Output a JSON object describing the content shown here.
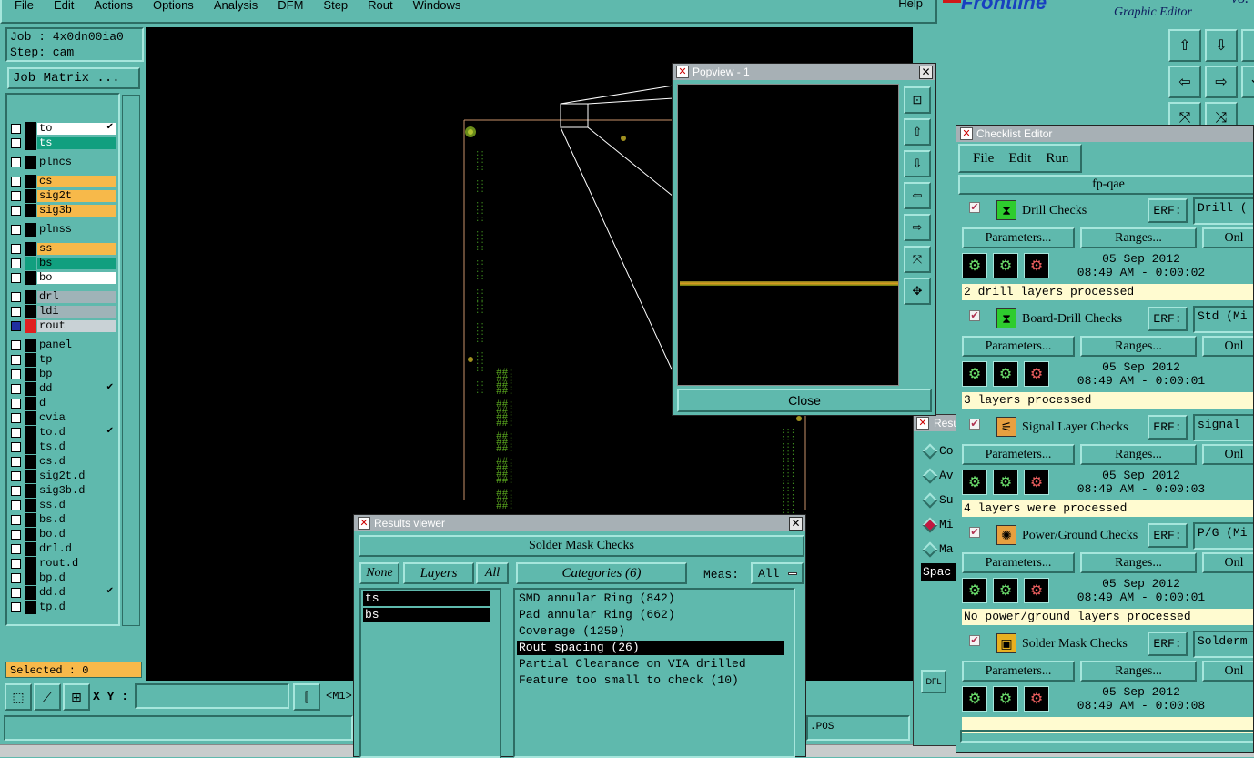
{
  "menu": [
    "File",
    "Edit",
    "Actions",
    "Options",
    "Analysis",
    "DFM",
    "Step",
    "Rout",
    "Windows"
  ],
  "help": "Help",
  "brand": {
    "logo": "Frontline",
    "subtitle": "Graphic Editor",
    "version": "v8."
  },
  "job": {
    "job_label": "Job : 4x0dn00ia0",
    "step_label": "Step: cam",
    "matrix_button": "Job Matrix ..."
  },
  "layers": [
    {
      "name": "to",
      "color": "#ffffff",
      "tick": true
    },
    {
      "name": "ts",
      "color": "#119f7f",
      "tick": false
    },
    {
      "name": "plncs",
      "color": "#5fb9ad",
      "tick": false
    },
    {
      "name": "cs",
      "color": "#f7b94a",
      "tick": false
    },
    {
      "name": "sig2t",
      "color": "#f7b94a",
      "tick": false
    },
    {
      "name": "sig3b",
      "color": "#f7b94a",
      "tick": false
    },
    {
      "name": "plnss",
      "color": "#5fb9ad",
      "tick": false
    },
    {
      "name": "ss",
      "color": "#f7b94a",
      "tick": false
    },
    {
      "name": "bs",
      "color": "#119f7f",
      "tick": false
    },
    {
      "name": "bo",
      "color": "#ffffff",
      "tick": false
    },
    {
      "name": "drl",
      "color": "#9fb3b8",
      "tick": false
    },
    {
      "name": "ldi",
      "color": "#9fb3b8",
      "tick": false
    },
    {
      "name": "rout",
      "color": "#c9d2d6",
      "tick": false
    },
    {
      "name": "panel",
      "color": "#5fb9ad",
      "tick": false
    },
    {
      "name": "tp",
      "color": "#5fb9ad",
      "tick": false
    },
    {
      "name": "bp",
      "color": "#5fb9ad",
      "tick": false
    },
    {
      "name": "dd",
      "color": "#5fb9ad",
      "tick": true
    },
    {
      "name": "d",
      "color": "#5fb9ad",
      "tick": false
    },
    {
      "name": "cvia",
      "color": "#5fb9ad",
      "tick": false
    },
    {
      "name": "to.d",
      "color": "#5fb9ad",
      "tick": true
    },
    {
      "name": "ts.d",
      "color": "#5fb9ad",
      "tick": false
    },
    {
      "name": "cs.d",
      "color": "#5fb9ad",
      "tick": false
    },
    {
      "name": "sig2t.d",
      "color": "#5fb9ad",
      "tick": false
    },
    {
      "name": "sig3b.d",
      "color": "#5fb9ad",
      "tick": false
    },
    {
      "name": "ss.d",
      "color": "#5fb9ad",
      "tick": false
    },
    {
      "name": "bs.d",
      "color": "#5fb9ad",
      "tick": false
    },
    {
      "name": "bo.d",
      "color": "#5fb9ad",
      "tick": false
    },
    {
      "name": "drl.d",
      "color": "#5fb9ad",
      "tick": false
    },
    {
      "name": "rout.d",
      "color": "#5fb9ad",
      "tick": false
    },
    {
      "name": "bp.d",
      "color": "#5fb9ad",
      "tick": false
    },
    {
      "name": "dd.d",
      "color": "#5fb9ad",
      "tick": true
    },
    {
      "name": "tp.d",
      "color": "#5fb9ad",
      "tick": false
    }
  ],
  "selected": "Selected : 0",
  "coords": {
    "xy_label": "X Y :",
    "xy_value": "",
    "unit": "<M1>"
  },
  "popview": {
    "title": "Popview - 1",
    "close": "Close"
  },
  "results": {
    "title": "Results viewer",
    "header": "Solder Mask Checks",
    "none": "None",
    "layers": "Layers",
    "all": "All",
    "categories_label": "Categories (6)",
    "meas_label": "Meas:",
    "meas_value": "All",
    "layer_items": [
      "ts",
      "bs"
    ],
    "categories": [
      "SMD annular Ring (842)",
      "Pad annular Ring (662)",
      "Coverage (1259)",
      "Rout spacing (26)",
      "Partial Clearance on VIA drilled",
      "Feature too small to check (10)"
    ],
    "selected_category": "Rout spacing (26)"
  },
  "res_behind": {
    "title": "Resu",
    "items": [
      "Co",
      "Av",
      "Su",
      "Mi",
      "Ma"
    ],
    "field": "Spac",
    "button": "DFL"
  },
  "checklist": {
    "title": "Checklist Editor",
    "menu": [
      "File",
      "Edit",
      "Run"
    ],
    "name": "fp-qae",
    "params_label": "Parameters...",
    "ranges_label": "Ranges...",
    "on_label": "Onl",
    "erf_label": "ERF:",
    "checks": [
      {
        "name": "Drill Checks",
        "erf": "Drill (",
        "date": "05 Sep 2012",
        "time": "08:49 AM - 0:00:02",
        "status": "2 drill layers processed",
        "icon": "drill-icon",
        "icon_color": "#2ecc2e"
      },
      {
        "name": "Board-Drill Checks",
        "erf": "Std (Mi",
        "date": "05 Sep 2012",
        "time": "08:49 AM - 0:00:01",
        "status": "3 layers processed",
        "icon": "drill-icon",
        "icon_color": "#2ecc2e"
      },
      {
        "name": "Signal Layer Checks",
        "erf": "signal",
        "date": "05 Sep 2012",
        "time": "08:49 AM - 0:00:03",
        "status": "4 layers were processed",
        "icon": "signal-icon",
        "icon_color": "#e8a040"
      },
      {
        "name": "Power/Ground Checks",
        "erf": "P/G (Mi",
        "date": "05 Sep 2012",
        "time": "08:49 AM - 0:00:01",
        "status": "No power/ground layers processed",
        "icon": "power-icon",
        "icon_color": "#e8a040"
      },
      {
        "name": "Solder Mask Checks",
        "erf": "Solderm",
        "date": "05 Sep 2012",
        "time": "08:49 AM - 0:00:08",
        "status": "",
        "icon": "soldermask-icon",
        "icon_color": "#e8b020"
      }
    ]
  },
  "status_right": ".POS"
}
